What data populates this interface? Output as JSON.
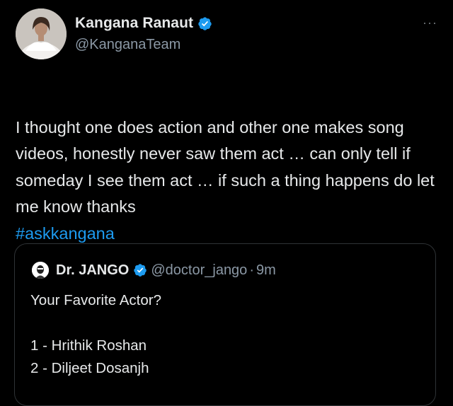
{
  "author": {
    "display_name": "Kangana Ranaut",
    "handle": "@KanganaTeam",
    "verified": true,
    "avatar": "profile-photo"
  },
  "more_menu": "···",
  "tweet": {
    "text": "I thought one does action and other one makes song videos, honestly never saw them act … can only tell if someday I see them act … if such a thing happens do let me know thanks",
    "hashtag": "#askkangana"
  },
  "quoted": {
    "display_name": "Dr. JANGO",
    "handle": "@doctor_jango",
    "separator": "·",
    "time": "9m",
    "verified": true,
    "line1": "Your Favorite Actor?",
    "option1": "1 - Hrithik Roshan",
    "option2": "2 - Diljeet Dosanjh"
  },
  "colors": {
    "background": "#000000",
    "text": "#e7e9ea",
    "secondary": "#8b98a5",
    "accent": "#1d9bf0",
    "border": "#2f3336"
  }
}
